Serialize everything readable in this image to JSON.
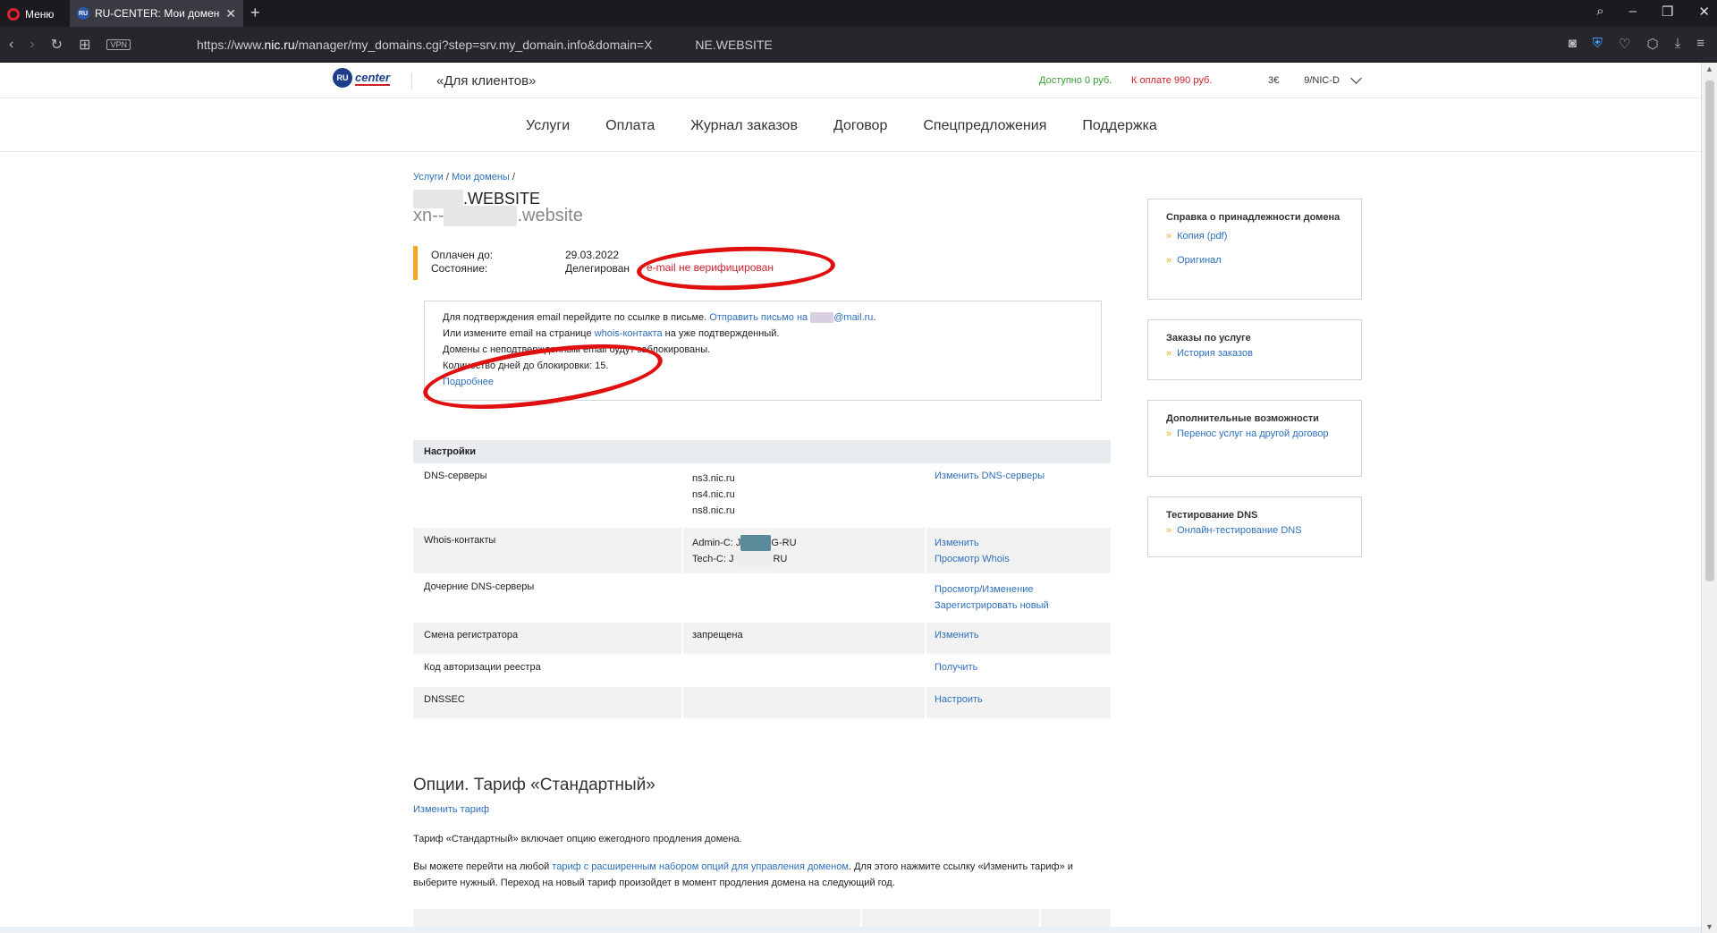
{
  "browser": {
    "menu_label": "Меню",
    "tab_title": "RU-CENTER: Мои доменн",
    "tab_favicon_text": "RU",
    "url_prefix": "https://www.",
    "url_host": "nic.ru",
    "url_path": "/manager/my_domains.cgi?step=srv.my_domain.info&domain=X",
    "url_suffix": "NE.WEBSITE",
    "vpn_label": "VPN"
  },
  "header": {
    "logo_ru": "RU",
    "logo_center": "center",
    "for_clients": "«Для клиентов»",
    "balance": "Доступно 0 руб.",
    "to_pay": "К оплате 990 руб.",
    "account_prefix": "3€",
    "account_suffix": "9/NIC-D"
  },
  "nav": {
    "items": [
      "Услуги",
      "Оплата",
      "Журнал заказов",
      "Договор",
      "Спецпредложения",
      "Поддержка"
    ]
  },
  "breadcrumb": {
    "item1": "Услуги",
    "item2": "Мои домены",
    "sep": "/"
  },
  "domain": {
    "name_suffix": ".WEBSITE",
    "puny_prefix": "xn--",
    "puny_suffix": ".website"
  },
  "status": {
    "paid_label": "Оплачен до:",
    "paid_value": "29.03.2022",
    "state_label": "Состояние:",
    "state_value": "Делегирован",
    "unverified": "e-mail не верифицирован"
  },
  "notice": {
    "line1_text": "Для подтверждения email перейдите по ссылке в письме.",
    "line1_link": "Отправить письмо на",
    "line1_email": "@mail.ru",
    "line2_pre": "Или измените email на странице",
    "line2_link": "whois-контакта",
    "line2_post": "на уже подтвержденный.",
    "line3": "Домены с неподтвержденным email будут заблокированы.",
    "line4": "Количество дней до блокировки: 15.",
    "more_link": "Подробнее"
  },
  "settings": {
    "title": "Настройки",
    "rows": [
      {
        "label": "DNS-серверы",
        "value": [
          "ns3.nic.ru",
          "ns4.nic.ru",
          "ns8.nic.ru"
        ],
        "actions": [
          "Изменить DNS-серверы"
        ]
      },
      {
        "label": "Whois-контакты",
        "value": [
          "Admin-C: J",
          "Tech-C: J"
        ],
        "value_suffix": [
          "G-RU",
          "RU"
        ],
        "actions": [
          "Изменить",
          "Просмотр Whois"
        ]
      },
      {
        "label": "Дочерние DNS-серверы",
        "value": [],
        "actions": [
          "Просмотр/Изменение",
          "Зарегистрировать новый"
        ]
      },
      {
        "label": "Смена регистратора",
        "value": [
          "запрещена"
        ],
        "actions": [
          "Изменить"
        ]
      },
      {
        "label": "Код авторизации реестра",
        "value": [],
        "actions": [
          "Получить"
        ]
      },
      {
        "label": "DNSSEC",
        "value": [],
        "actions": [
          "Настроить"
        ]
      }
    ]
  },
  "options": {
    "title": "Опции. Тариф «Стандартный»",
    "change_tariff": "Изменить тариф",
    "text1": "Тариф «Стандартный» включает опцию ежегодного продления домена.",
    "text2_pre": "Вы можете перейти на любой",
    "text2_link": "тариф с расширенным набором опций для управления доменом",
    "text2_post": ". Для этого нажмите ссылку «Изменить тариф» и выберите нужный. Переход на новый тариф произойдет в момент продления домена на следующий год."
  },
  "sidebar": {
    "boxes": [
      {
        "title": "Справка о принадлежности домена",
        "links": [
          "Копия (pdf)",
          "Оригинал"
        ]
      },
      {
        "title": "Заказы по услуге",
        "links": [
          "История заказов"
        ]
      },
      {
        "title": "Дополнительные возможности",
        "links": [
          "Перенос услуг на другой договор"
        ]
      },
      {
        "title": "Тестирование DNS",
        "links": [
          "Онлайн-тестирование DNS"
        ]
      }
    ]
  },
  "colors": {
    "accent_orange": "#f5a623",
    "link_blue": "#2f6fba",
    "alert_red": "#d0202a",
    "balance_green": "#3a9a32",
    "annotation_red": "#e01010"
  }
}
